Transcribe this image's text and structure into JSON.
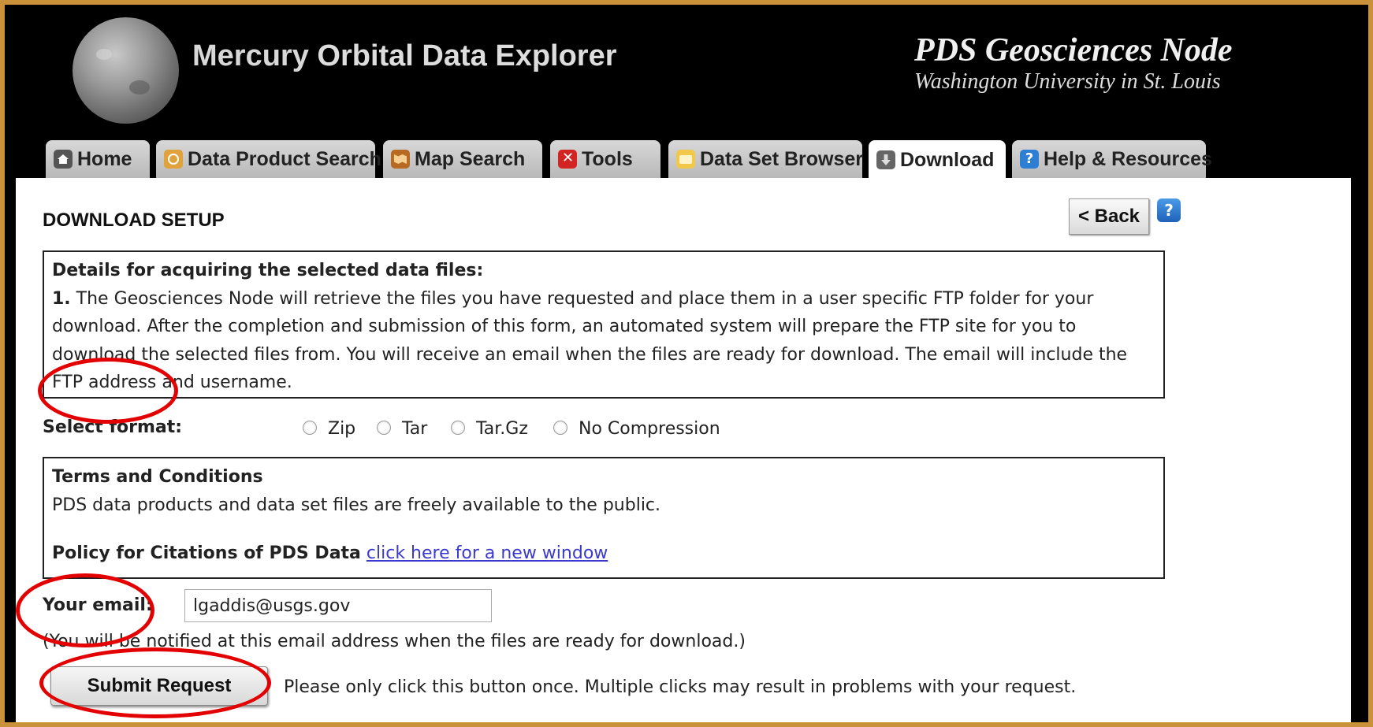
{
  "header": {
    "app_title_1": "Mercury",
    "app_title_2": "Orbital Data Explorer",
    "node_title": "PDS Geosciences Node",
    "node_subtitle": "Washington University in St. Louis"
  },
  "tabs": [
    {
      "label": "Home",
      "icon": "home-icon"
    },
    {
      "label": "Data Product Search",
      "icon": "search-icon"
    },
    {
      "label": "Map Search",
      "icon": "map-icon"
    },
    {
      "label": "Tools",
      "icon": "tools-icon"
    },
    {
      "label": "Data Set Browser",
      "icon": "folder-icon"
    },
    {
      "label": "Download",
      "icon": "download-icon",
      "active": true
    },
    {
      "label": "Help & Resources",
      "icon": "help-icon"
    }
  ],
  "page": {
    "title": "DOWNLOAD SETUP",
    "back_label": "< Back",
    "help_glyph": "?"
  },
  "details": {
    "heading": "Details for acquiring the selected data files:",
    "step_number": "1.",
    "text": " The Geosciences Node will retrieve the files you have requested and place them in a user specific FTP folder for your download. After the completion and submission of this form, an automated system will prepare the FTP site for you to download the selected files from. You will receive an email when the files are ready for download. The email will include the FTP address and username."
  },
  "format": {
    "label": "Select format:",
    "options": [
      "Zip",
      "Tar",
      "Tar.Gz",
      "No Compression"
    ]
  },
  "terms": {
    "heading": "Terms and Conditions",
    "text": "PDS data products and data set files are freely available to the public.",
    "policy_label": "Policy for Citations of PDS Data",
    "policy_link": "click here for a new window"
  },
  "email": {
    "label": "Your email:",
    "value": "lgaddis@usgs.gov",
    "note": "(You will be notified at this email address when the files are ready for download.)"
  },
  "submit": {
    "label": "Submit Request",
    "note": "Please only click this button once. Multiple clicks may result in problems with your request."
  },
  "colors": {
    "frame": "#c9923a",
    "annotation": "#e30000",
    "link": "#3a3ad0"
  }
}
